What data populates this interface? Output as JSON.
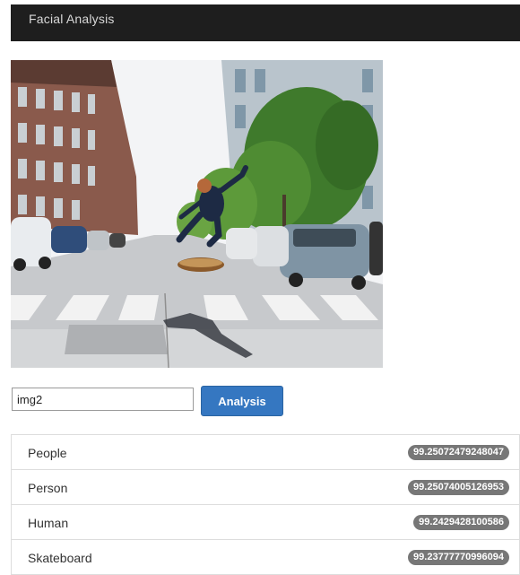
{
  "app": {
    "title": "Facial Analysis"
  },
  "photo": {
    "description_icon": "skateboarder-street-photo"
  },
  "form": {
    "input_value": "img2",
    "button_label": "Analysis"
  },
  "results": [
    {
      "label": "People",
      "score": "99.25072479248047"
    },
    {
      "label": "Person",
      "score": "99.25074005126953"
    },
    {
      "label": "Human",
      "score": "99.2429428100586"
    },
    {
      "label": "Skateboard",
      "score": "99.23777770996094"
    }
  ],
  "colors": {
    "navbar": "#1e1e1e",
    "button": "#3577c1",
    "badge": "#777777"
  }
}
